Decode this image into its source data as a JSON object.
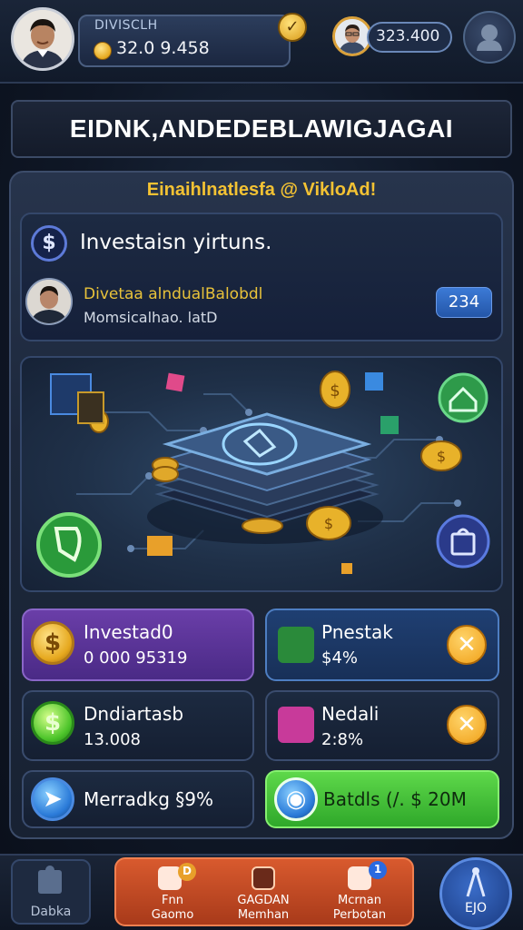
{
  "header": {
    "player_name": "DIVISCLH",
    "player_coins": "32.0 9.458",
    "rival_score": "323.400"
  },
  "title": "EIDNK,ANDEDEBLAWIGJAGAI",
  "promo": "Einaihlnatlesfa @ VikloAd!",
  "info": {
    "heading": "Investaisn yirtuns.",
    "agent_name": "Divetaa alndualBalobdl",
    "agent_sub": "Momsicalhao. latD",
    "score": "234"
  },
  "cards": {
    "invested": {
      "label": "Investad0",
      "value": "0 000 95319"
    },
    "pnestak": {
      "label": "Pnestak",
      "value": "$4%"
    },
    "dividends": {
      "label": "Dndiartasb",
      "value": "13.008"
    },
    "deal": {
      "label": "Nedali",
      "value": "2:8%"
    },
    "market": {
      "label": "Merradkg §9%"
    },
    "details": {
      "label": "Batdls (/. $ 20M"
    }
  },
  "bottom_nav": {
    "left_label": "Dabka",
    "items": [
      {
        "line1": "Fnn",
        "line2": "Gaomo",
        "badge": "D"
      },
      {
        "line1": "GAGDAN",
        "line2": "Memhan"
      },
      {
        "line1": "Mcrnan",
        "line2": "Perbotan",
        "badge": "1"
      }
    ],
    "right_label": "EJO"
  },
  "colors": {
    "accent_gold": "#f3c233",
    "invest_purple": "#6a3ea8",
    "details_green": "#4cc42a",
    "nav_orange": "#d85a2e"
  }
}
